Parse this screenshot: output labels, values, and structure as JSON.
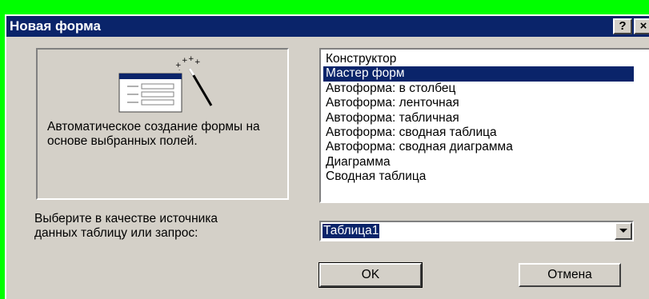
{
  "window": {
    "title": "Новая форма",
    "help_label": "?",
    "close_label": "×"
  },
  "preview": {
    "icon": "form-wizard-icon",
    "description": "Автоматическое создание формы на основе выбранных полей."
  },
  "form_types": {
    "items": [
      "Конструктор",
      "Мастер форм",
      "Автоформа: в столбец",
      "Автоформа: ленточная",
      "Автоформа: табличная",
      "Автоформа:  сводная таблица",
      "Автоформа:  сводная диаграмма",
      "Диаграмма",
      "Сводная таблица"
    ],
    "selected_index": 1
  },
  "source": {
    "label": "Выберите в качестве источника данных таблицу или запрос:",
    "value": "Таблица1"
  },
  "buttons": {
    "ok": "OK",
    "cancel": "Отмена"
  },
  "colors": {
    "titlebar": "#0a246a",
    "dialog_face": "#d4d0c8",
    "selection": "#0a246a",
    "background": "#00ff00"
  }
}
